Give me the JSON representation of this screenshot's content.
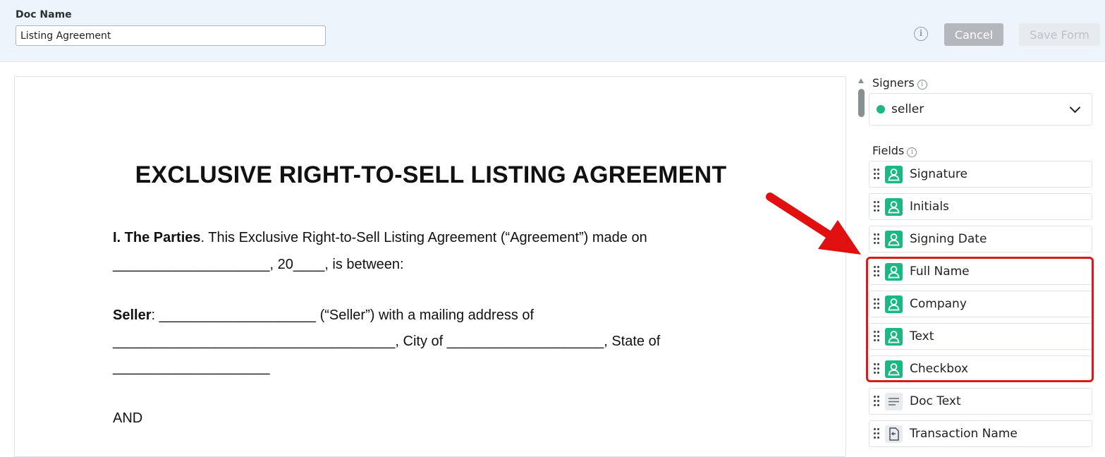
{
  "header": {
    "doc_name_label": "Doc Name",
    "doc_name_value": "Listing Agreement",
    "info_icon": "info-icon",
    "cancel_label": "Cancel",
    "save_label": "Save Form"
  },
  "document": {
    "title": "EXCLUSIVE RIGHT-TO-SELL LISTING AGREEMENT",
    "parties_heading": "I. The Parties",
    "parties_text": ". This Exclusive Right-to-Sell Listing Agreement (“Agreement”) made on",
    "line2": "____________________, 20____, is between:",
    "seller_heading": "Seller",
    "seller_text": ": ____________________ (“Seller”) with a mailing address of",
    "line4": "____________________________________, City of ____________________, State of",
    "line5": "____________________",
    "and_text": "AND"
  },
  "panel": {
    "signers_label": "Signers",
    "signer_selected": "seller",
    "signer_color": "#1cb884",
    "fields_label": "Fields",
    "fields": [
      {
        "label": "Signature",
        "icon": "person-icon"
      },
      {
        "label": "Initials",
        "icon": "person-icon"
      },
      {
        "label": "Signing Date",
        "icon": "person-icon"
      },
      {
        "label": "Full Name",
        "icon": "person-icon"
      },
      {
        "label": "Company",
        "icon": "person-icon"
      },
      {
        "label": "Text",
        "icon": "person-icon"
      },
      {
        "label": "Checkbox",
        "icon": "person-icon"
      },
      {
        "label": "Doc Text",
        "icon": "text-lines-icon"
      },
      {
        "label": "Transaction Name",
        "icon": "document-arrow-icon"
      }
    ]
  },
  "colors": {
    "accent_green": "#1cb884",
    "highlight_red": "#d41c1c",
    "header_bg": "#eef4fb"
  }
}
